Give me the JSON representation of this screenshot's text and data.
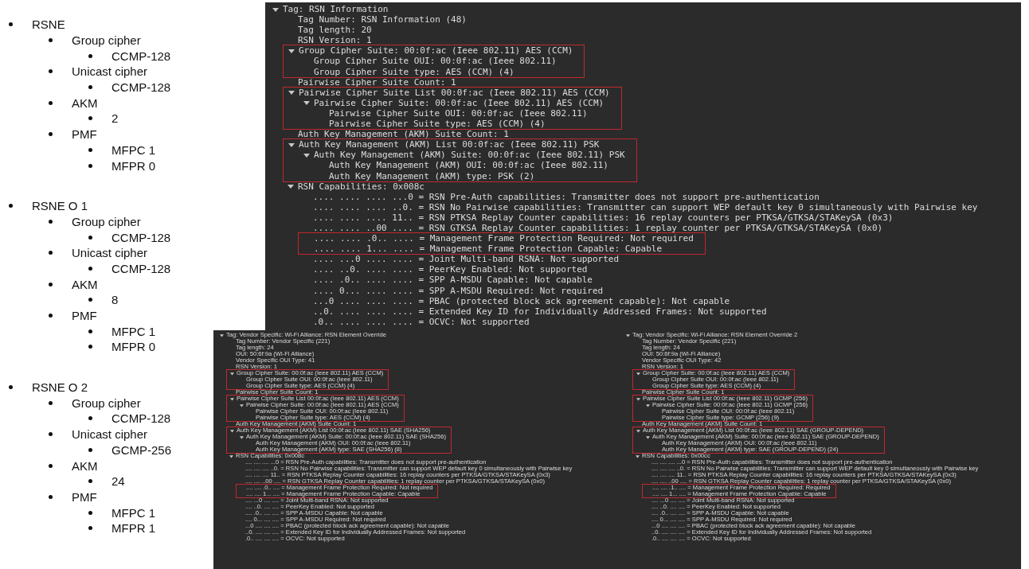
{
  "summary_list": [
    {
      "text": "RSNE",
      "children": [
        {
          "text": "Group cipher",
          "children": [
            {
              "text": "CCMP-128"
            }
          ]
        },
        {
          "text": "Unicast cipher",
          "children": [
            {
              "text": "CCMP-128"
            }
          ]
        },
        {
          "text": "AKM",
          "children": [
            {
              "text": "2"
            }
          ]
        },
        {
          "text": "PMF",
          "children": [
            {
              "text": "MFPC 1"
            },
            {
              "text": "MFPR 0"
            }
          ]
        }
      ]
    },
    {
      "text": "RSNE O 1",
      "children": [
        {
          "text": "Group cipher",
          "children": [
            {
              "text": "CCMP-128"
            }
          ]
        },
        {
          "text": "Unicast cipher",
          "children": [
            {
              "text": "CCMP-128"
            }
          ]
        },
        {
          "text": "AKM",
          "children": [
            {
              "text": "8"
            }
          ]
        },
        {
          "text": "PMF",
          "children": [
            {
              "text": "MFPC 1"
            },
            {
              "text": "MFPR 0"
            }
          ]
        }
      ]
    },
    {
      "text": "RSNE O 2",
      "children": [
        {
          "text": "Group cipher",
          "children": [
            {
              "text": "CCMP-128"
            }
          ]
        },
        {
          "text": "Unicast cipher",
          "children": [
            {
              "text": "GCMP-256"
            }
          ]
        },
        {
          "text": "AKM",
          "children": [
            {
              "text": "24"
            }
          ]
        },
        {
          "text": "PMF",
          "children": [
            {
              "text": "MFPC 1"
            },
            {
              "text": "MFPR 1"
            }
          ]
        }
      ]
    }
  ],
  "rsn_capture": {
    "tree": [
      {
        "text": "Tag: RSN Information",
        "expanded": true,
        "highlighted": false,
        "children": [
          {
            "text": "Tag Number: RSN Information (48)",
            "highlighted": false
          },
          {
            "text": "Tag length: 20",
            "highlighted": false
          },
          {
            "text": "RSN Version: 1",
            "highlighted": false
          },
          {
            "text": "Group Cipher Suite: 00:0f:ac (Ieee 802.11) AES (CCM)",
            "expanded": true,
            "highlighted": true,
            "children": [
              {
                "text": "Group Cipher Suite OUI: 00:0f:ac (Ieee 802.11)",
                "highlighted": false
              },
              {
                "text": "Group Cipher Suite type: AES (CCM) (4)",
                "highlighted": false
              }
            ]
          },
          {
            "text": "Pairwise Cipher Suite Count: 1",
            "highlighted": false
          },
          {
            "text": "Pairwise Cipher Suite List 00:0f:ac (Ieee 802.11) AES (CCM)",
            "expanded": true,
            "highlighted": true,
            "children": [
              {
                "text": "Pairwise Cipher Suite: 00:0f:ac (Ieee 802.11) AES (CCM)",
                "expanded": true,
                "highlighted": false,
                "children": [
                  {
                    "text": "Pairwise Cipher Suite OUI: 00:0f:ac (Ieee 802.11)",
                    "highlighted": false
                  },
                  {
                    "text": "Pairwise Cipher Suite type: AES (CCM) (4)",
                    "highlighted": false
                  }
                ]
              }
            ]
          },
          {
            "text": "Auth Key Management (AKM) Suite Count: 1",
            "highlighted": false
          },
          {
            "text": "Auth Key Management (AKM) List 00:0f:ac (Ieee 802.11) PSK",
            "expanded": true,
            "highlighted": true,
            "children": [
              {
                "text": "Auth Key Management (AKM) Suite: 00:0f:ac (Ieee 802.11) PSK",
                "expanded": true,
                "highlighted": false,
                "children": [
                  {
                    "text": "Auth Key Management (AKM) OUI: 00:0f:ac (Ieee 802.11)",
                    "highlighted": false
                  },
                  {
                    "text": "Auth Key Management (AKM) type: PSK (2)",
                    "highlighted": false
                  }
                ]
              }
            ]
          },
          {
            "text": "RSN Capabilities: 0x008c",
            "expanded": true,
            "highlighted": false,
            "children": [
              {
                "text": ".... .... .... ...0 = RSN Pre-Auth capabilities: Transmitter does not support pre-authentication",
                "highlighted": false
              },
              {
                "text": ".... .... .... ..0. = RSN No Pairwise capabilities: Transmitter can support WEP default key 0 simultaneously with Pairwise key",
                "highlighted": false
              },
              {
                "text": ".... .... .... 11.. = RSN PTKSA Replay Counter capabilities: 16 replay counters per PTKSA/GTKSA/STAKeySA (0x3)",
                "highlighted": false
              },
              {
                "text": ".... .... ..00 .... = RSN GTKSA Replay Counter capabilities: 1 replay counter per PTKSA/GTKSA/STAKeySA (0x0)",
                "highlighted": false
              },
              {
                "text": ".... .... .0.. .... = Management Frame Protection Required: Not required",
                "highlighted": true
              },
              {
                "text": ".... .... 1... .... = Management Frame Protection Capable: Capable",
                "highlighted": true
              },
              {
                "text": ".... ...0 .... .... = Joint Multi-band RSNA: Not supported",
                "highlighted": false
              },
              {
                "text": ".... ..0. .... .... = PeerKey Enabled: Not supported",
                "highlighted": false
              },
              {
                "text": ".... .0.. .... .... = SPP A-MSDU Capable: Not capable",
                "highlighted": false
              },
              {
                "text": ".... 0... .... .... = SPP A-MSDU Required: Not required",
                "highlighted": false
              },
              {
                "text": "...0 .... .... .... = PBAC (protected block ack agreement capable): Not capable",
                "highlighted": false
              },
              {
                "text": "..0. .... .... .... = Extended Key ID for Individually Addressed Frames: Not supported",
                "highlighted": false
              },
              {
                "text": ".0.. .... .... .... = OCVC: Not supported",
                "highlighted": false
              }
            ]
          }
        ]
      }
    ]
  },
  "override_captures": [
    {
      "tree": [
        {
          "text": "Tag: Vendor Specific: Wi-Fi Alliance: RSN Element Override",
          "expanded": true,
          "highlighted": false,
          "children": [
            {
              "text": "Tag Number: Vendor Specific (221)",
              "highlighted": false
            },
            {
              "text": "Tag length: 24",
              "highlighted": false
            },
            {
              "text": "OUI: 50:6f:9a (Wi-Fi Alliance)",
              "highlighted": false
            },
            {
              "text": "Vendor Specific OUI Type: 41",
              "highlighted": false
            },
            {
              "text": "RSN Version: 1",
              "highlighted": false
            },
            {
              "text": "Group Cipher Suite: 00:0f:ac (Ieee 802.11) AES (CCM)",
              "expanded": true,
              "highlighted": true,
              "children": [
                {
                  "text": "Group Cipher Suite OUI: 00:0f:ac (Ieee 802.11)",
                  "highlighted": false
                },
                {
                  "text": "Group Cipher Suite type: AES (CCM) (4)",
                  "highlighted": false
                }
              ]
            },
            {
              "text": "Pairwise Cipher Suite Count: 1",
              "highlighted": false
            },
            {
              "text": "Pairwise Cipher Suite List 00:0f:ac (Ieee 802.11) AES (CCM)",
              "expanded": true,
              "highlighted": true,
              "children": [
                {
                  "text": "Pairwise Cipher Suite: 00:0f:ac (Ieee 802.11) AES (CCM)",
                  "expanded": true,
                  "highlighted": false,
                  "children": [
                    {
                      "text": "Pairwise Cipher Suite OUI: 00:0f:ac (Ieee 802.11)",
                      "highlighted": false
                    },
                    {
                      "text": "Pairwise Cipher Suite type: AES (CCM) (4)",
                      "highlighted": false
                    }
                  ]
                }
              ]
            },
            {
              "text": "Auth Key Management (AKM) Suite Count: 1",
              "highlighted": false
            },
            {
              "text": "Auth Key Management (AKM) List 00:0f:ac (Ieee 802.11) SAE (SHA256)",
              "expanded": true,
              "highlighted": true,
              "children": [
                {
                  "text": "Auth Key Management (AKM) Suite: 00:0f:ac (Ieee 802.11) SAE (SHA256)",
                  "expanded": true,
                  "highlighted": false,
                  "children": [
                    {
                      "text": "Auth Key Management (AKM) OUI: 00:0f:ac (Ieee 802.11)",
                      "highlighted": false
                    },
                    {
                      "text": "Auth Key Management (AKM) type: SAE (SHA256) (8)",
                      "highlighted": false
                    }
                  ]
                }
              ]
            },
            {
              "text": "RSN Capabilities: 0x008c",
              "expanded": true,
              "highlighted": false,
              "children": [
                {
                  "text": ".... .... .... ...0 = RSN Pre-Auth capabilities: Transmitter does not support pre-authentication",
                  "highlighted": false
                },
                {
                  "text": ".... .... .... ..0. = RSN No Pairwise capabilities: Transmitter can support WEP default key 0 simultaneously with Pairwise key",
                  "highlighted": false
                },
                {
                  "text": ".... .... .... 11.. = RSN PTKSA Replay Counter capabilities: 16 replay counters per PTKSA/GTKSA/STAKeySA (0x3)",
                  "highlighted": false
                },
                {
                  "text": ".... .... ..00 .... = RSN GTKSA Replay Counter capabilities: 1 replay counter per PTKSA/GTKSA/STAKeySA (0x0)",
                  "highlighted": false
                },
                {
                  "text": ".... .... .0.. .... = Management Frame Protection Required: Not required",
                  "highlighted": true
                },
                {
                  "text": ".... .... 1... .... = Management Frame Protection Capable: Capable",
                  "highlighted": true
                },
                {
                  "text": ".... ...0 .... .... = Joint Multi-band RSNA: Not supported",
                  "highlighted": false
                },
                {
                  "text": ".... ..0. .... .... = PeerKey Enabled: Not supported",
                  "highlighted": false
                },
                {
                  "text": ".... .0.. .... .... = SPP A-MSDU Capable: Not capable",
                  "highlighted": false
                },
                {
                  "text": ".... 0... .... .... = SPP A-MSDU Required: Not required",
                  "highlighted": false
                },
                {
                  "text": "...0 .... .... .... = PBAC (protected block ack agreement capable): Not capable",
                  "highlighted": false
                },
                {
                  "text": "..0. .... .... .... = Extended Key ID for Individually Addressed Frames: Not supported",
                  "highlighted": false
                },
                {
                  "text": ".0.. .... .... .... = OCVC: Not supported",
                  "highlighted": false
                }
              ]
            }
          ]
        }
      ]
    },
    {
      "tree": [
        {
          "text": "Tag: Vendor Specific: Wi-Fi Alliance: RSN Element Override 2",
          "expanded": true,
          "highlighted": false,
          "children": [
            {
              "text": "Tag Number: Vendor Specific (221)",
              "highlighted": false
            },
            {
              "text": "Tag length: 24",
              "highlighted": false
            },
            {
              "text": "OUI: 50:6f:9a (Wi-Fi Alliance)",
              "highlighted": false
            },
            {
              "text": "Vendor Specific OUI Type: 42",
              "highlighted": false
            },
            {
              "text": "RSN Version: 1",
              "highlighted": false
            },
            {
              "text": "Group Cipher Suite: 00:0f:ac (Ieee 802.11) AES (CCM)",
              "expanded": true,
              "highlighted": true,
              "children": [
                {
                  "text": "Group Cipher Suite OUI: 00:0f:ac (Ieee 802.11)",
                  "highlighted": false
                },
                {
                  "text": "Group Cipher Suite type: AES (CCM) (4)",
                  "highlighted": false
                }
              ]
            },
            {
              "text": "Pairwise Cipher Suite Count: 1",
              "highlighted": false
            },
            {
              "text": "Pairwise Cipher Suite List 00:0f:ac (Ieee 802.11) GCMP (256)",
              "expanded": true,
              "highlighted": true,
              "children": [
                {
                  "text": "Pairwise Cipher Suite: 00:0f:ac (Ieee 802.11) GCMP (256)",
                  "expanded": true,
                  "highlighted": false,
                  "children": [
                    {
                      "text": "Pairwise Cipher Suite OUI: 00:0f:ac (Ieee 802.11)",
                      "highlighted": false
                    },
                    {
                      "text": "Pairwise Cipher Suite type: GCMP (256) (9)",
                      "highlighted": false
                    }
                  ]
                }
              ]
            },
            {
              "text": "Auth Key Management (AKM) Suite Count: 1",
              "highlighted": false
            },
            {
              "text": "Auth Key Management (AKM) List 00:0f:ac (Ieee 802.11) SAE (GROUP-DEPEND)",
              "expanded": true,
              "highlighted": true,
              "children": [
                {
                  "text": "Auth Key Management (AKM) Suite: 00:0f:ac (Ieee 802.11) SAE (GROUP-DEPEND)",
                  "expanded": true,
                  "highlighted": false,
                  "children": [
                    {
                      "text": "Auth Key Management (AKM) OUI: 00:0f:ac (Ieee 802.11)",
                      "highlighted": false
                    },
                    {
                      "text": "Auth Key Management (AKM) type: SAE (GROUP-DEPEND) (24)",
                      "highlighted": false
                    }
                  ]
                }
              ]
            },
            {
              "text": "RSN Capabilities: 0x00cc",
              "expanded": true,
              "highlighted": false,
              "children": [
                {
                  "text": ".... .... .... ...0 = RSN Pre-Auth capabilities: Transmitter does not support pre-authentication",
                  "highlighted": false
                },
                {
                  "text": ".... .... .... ..0. = RSN No Pairwise capabilities: Transmitter can support WEP default key 0 simultaneously with Pairwise key",
                  "highlighted": false
                },
                {
                  "text": ".... .... .... 11.. = RSN PTKSA Replay Counter capabilities: 16 replay counters per PTKSA/GTKSA/STAKeySA (0x3)",
                  "highlighted": false
                },
                {
                  "text": ".... .... ..00 .... = RSN GTKSA Replay Counter capabilities: 1 replay counter per PTKSA/GTKSA/STAKeySA (0x0)",
                  "highlighted": false
                },
                {
                  "text": ".... .... .1.. .... = Management Frame Protection Required: Required",
                  "highlighted": true
                },
                {
                  "text": ".... .... 1... .... = Management Frame Protection Capable: Capable",
                  "highlighted": true
                },
                {
                  "text": ".... ...0 .... .... = Joint Multi-band RSNA: Not supported",
                  "highlighted": false
                },
                {
                  "text": ".... ..0. .... .... = PeerKey Enabled: Not supported",
                  "highlighted": false
                },
                {
                  "text": ".... .0.. .... .... = SPP A-MSDU Capable: Not capable",
                  "highlighted": false
                },
                {
                  "text": ".... 0... .... .... = SPP A-MSDU Required: Not required",
                  "highlighted": false
                },
                {
                  "text": "...0 .... .... .... = PBAC (protected block ack agreement capable): Not capable",
                  "highlighted": false
                },
                {
                  "text": "..0. .... .... .... = Extended Key ID for Individually Addressed Frames: Not supported",
                  "highlighted": false
                },
                {
                  "text": ".0.. .... .... .... = OCVC: Not supported",
                  "highlighted": false
                }
              ]
            }
          ]
        }
      ]
    }
  ]
}
